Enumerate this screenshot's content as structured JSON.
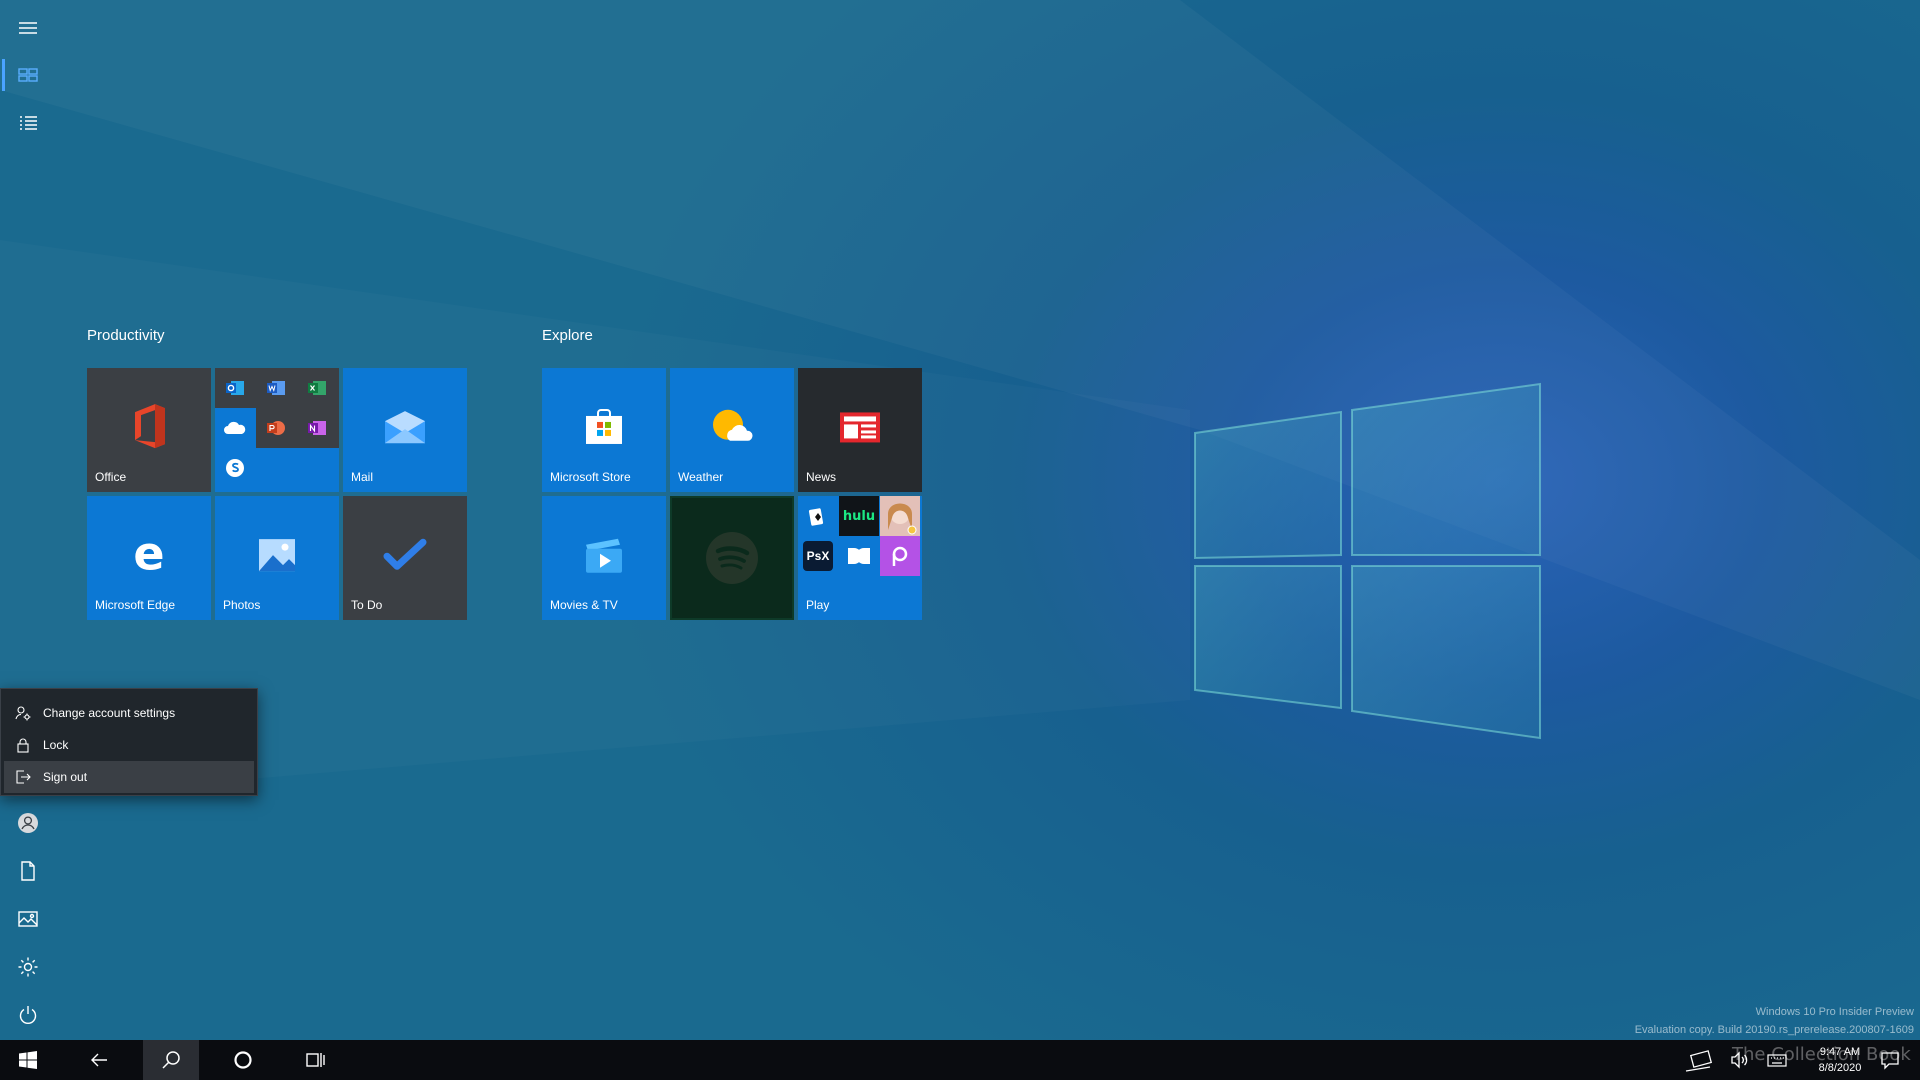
{
  "groups": {
    "productivity": {
      "title": "Productivity",
      "tiles": {
        "office": "Office",
        "mail": "Mail",
        "edge": "Microsoft Edge",
        "photos": "Photos",
        "todo": "To Do"
      }
    },
    "explore": {
      "title": "Explore",
      "tiles": {
        "store": "Microsoft Store",
        "weather": "Weather",
        "news": "News",
        "movies": "Movies & TV",
        "play": "Play"
      }
    }
  },
  "mini_labels": {
    "hulu": "hulu",
    "psx": "PsX"
  },
  "account_menu": {
    "items": [
      "Change account settings",
      "Lock",
      "Sign out"
    ]
  },
  "watermark": {
    "line1": "Windows 10 Pro Insider Preview",
    "line2": "Evaluation copy. Build 20190.rs_prerelease.200807-1609"
  },
  "clock": {
    "time": "9:47 AM",
    "date": "8/8/2020"
  },
  "brand": "The Collection Book",
  "colors": {
    "tile_blue": "#0c78d4",
    "tile_gray": "#3b3f44",
    "accent": "#4aa3ff",
    "taskbar": "#0a0c10"
  }
}
